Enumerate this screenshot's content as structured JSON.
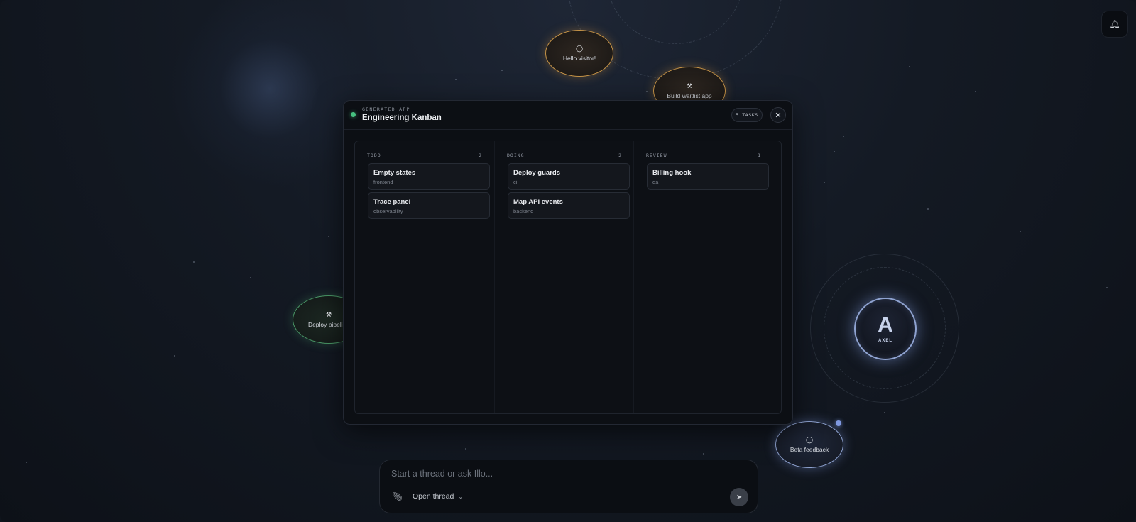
{
  "canvas": {
    "bubbles": [
      {
        "label": "Hello visitor!",
        "icon": "chat-icon",
        "variant": "orange"
      },
      {
        "label": "Build waitlist app",
        "icon": "hammer-icon",
        "variant": "orange"
      },
      {
        "label": "Deploy pipeline",
        "icon": "hammer-icon",
        "variant": "green"
      },
      {
        "label": "Beta feedback",
        "icon": "chat-icon",
        "variant": "blue"
      }
    ],
    "agent": {
      "letter": "A",
      "name": "AXEL"
    }
  },
  "topbar": {
    "notification_icon": "bell-icon"
  },
  "modal": {
    "overline": "GENERATED APP",
    "title": "Engineering Kanban",
    "task_count_label": "5 TASKS",
    "status_color": "#46c07f",
    "columns": [
      {
        "name": "TODO",
        "count": "2",
        "cards": [
          {
            "title": "Empty states",
            "tag": "frontend"
          },
          {
            "title": "Trace panel",
            "tag": "observability"
          }
        ]
      },
      {
        "name": "DOING",
        "count": "2",
        "cards": [
          {
            "title": "Deploy guards",
            "tag": "ci"
          },
          {
            "title": "Map API events",
            "tag": "backend"
          }
        ]
      },
      {
        "name": "REVIEW",
        "count": "1",
        "cards": [
          {
            "title": "Billing hook",
            "tag": "qa"
          }
        ]
      }
    ]
  },
  "composer": {
    "placeholder": "Start a thread or ask Illo...",
    "value": "",
    "mode_label": "Open thread"
  },
  "colors": {
    "accent_orange": "#c79447",
    "accent_green": "#4c9c69",
    "accent_blue": "#8fa3d1"
  }
}
